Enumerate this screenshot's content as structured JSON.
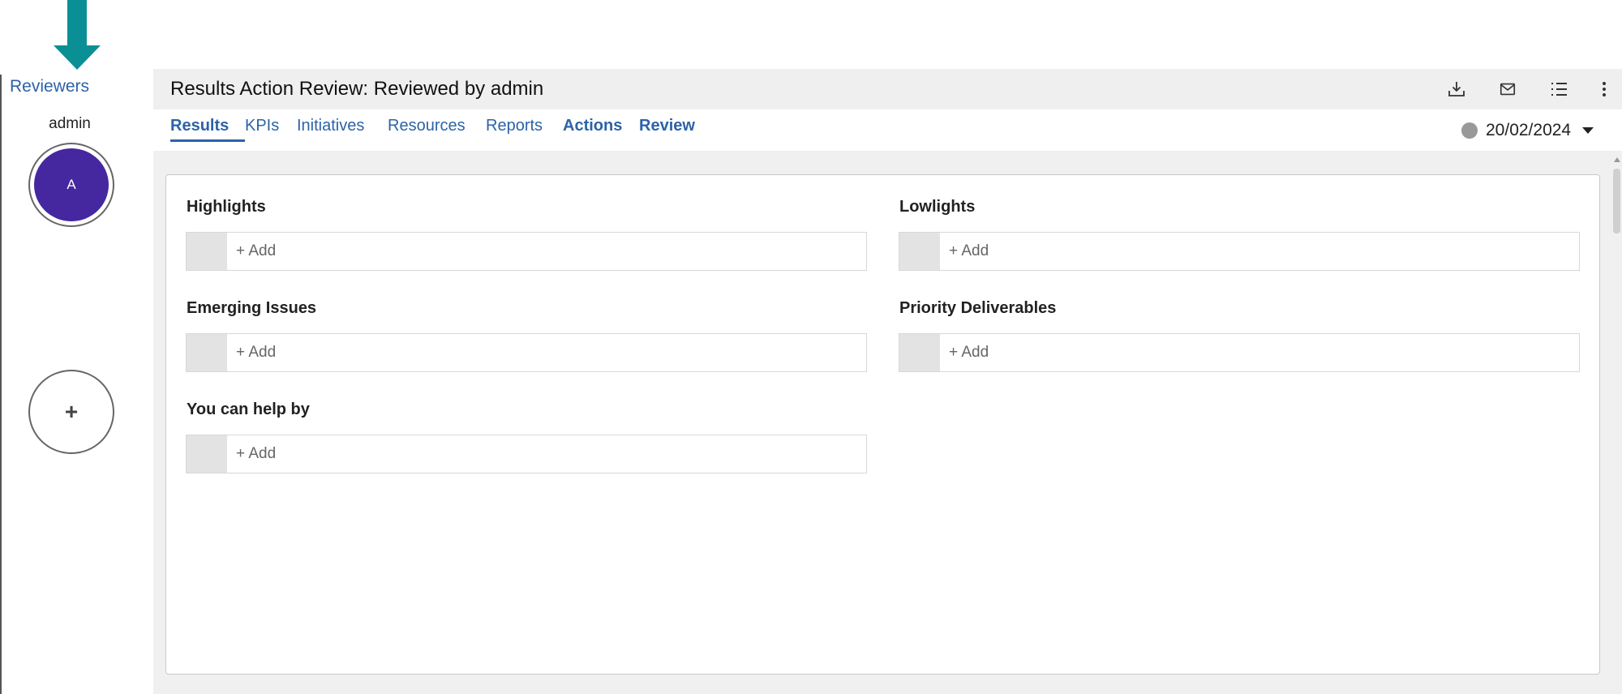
{
  "sidebar": {
    "reviewers_label": "Reviewers",
    "reviewer_name": "admin",
    "reviewer_initial": "A",
    "add_reviewer_symbol": "+"
  },
  "header": {
    "title": "Results Action Review: Reviewed by admin",
    "icons": [
      "download-tray-icon",
      "mail-icon",
      "list-icon",
      "more-vertical-icon"
    ]
  },
  "tabs": [
    {
      "label": "Results",
      "active": true
    },
    {
      "label": "KPIs"
    },
    {
      "label": "Initiatives"
    },
    {
      "label": "Resources"
    },
    {
      "label": "Reports"
    },
    {
      "label": "Actions"
    },
    {
      "label": "Review"
    }
  ],
  "date_picker": {
    "value": "20/02/2024",
    "status_color": "#999999"
  },
  "sections": [
    {
      "label": "Highlights",
      "add_label": "+ Add"
    },
    {
      "label": "Lowlights",
      "add_label": "+ Add"
    },
    {
      "label": "Emerging Issues",
      "add_label": "+ Add"
    },
    {
      "label": "Priority Deliverables",
      "add_label": "+ Add"
    },
    {
      "label": "You can help by",
      "add_label": "+ Add"
    }
  ],
  "colors": {
    "accent": "#2c63a8",
    "avatar": "#4527a0",
    "callout_arrow": "#0a8f95"
  }
}
